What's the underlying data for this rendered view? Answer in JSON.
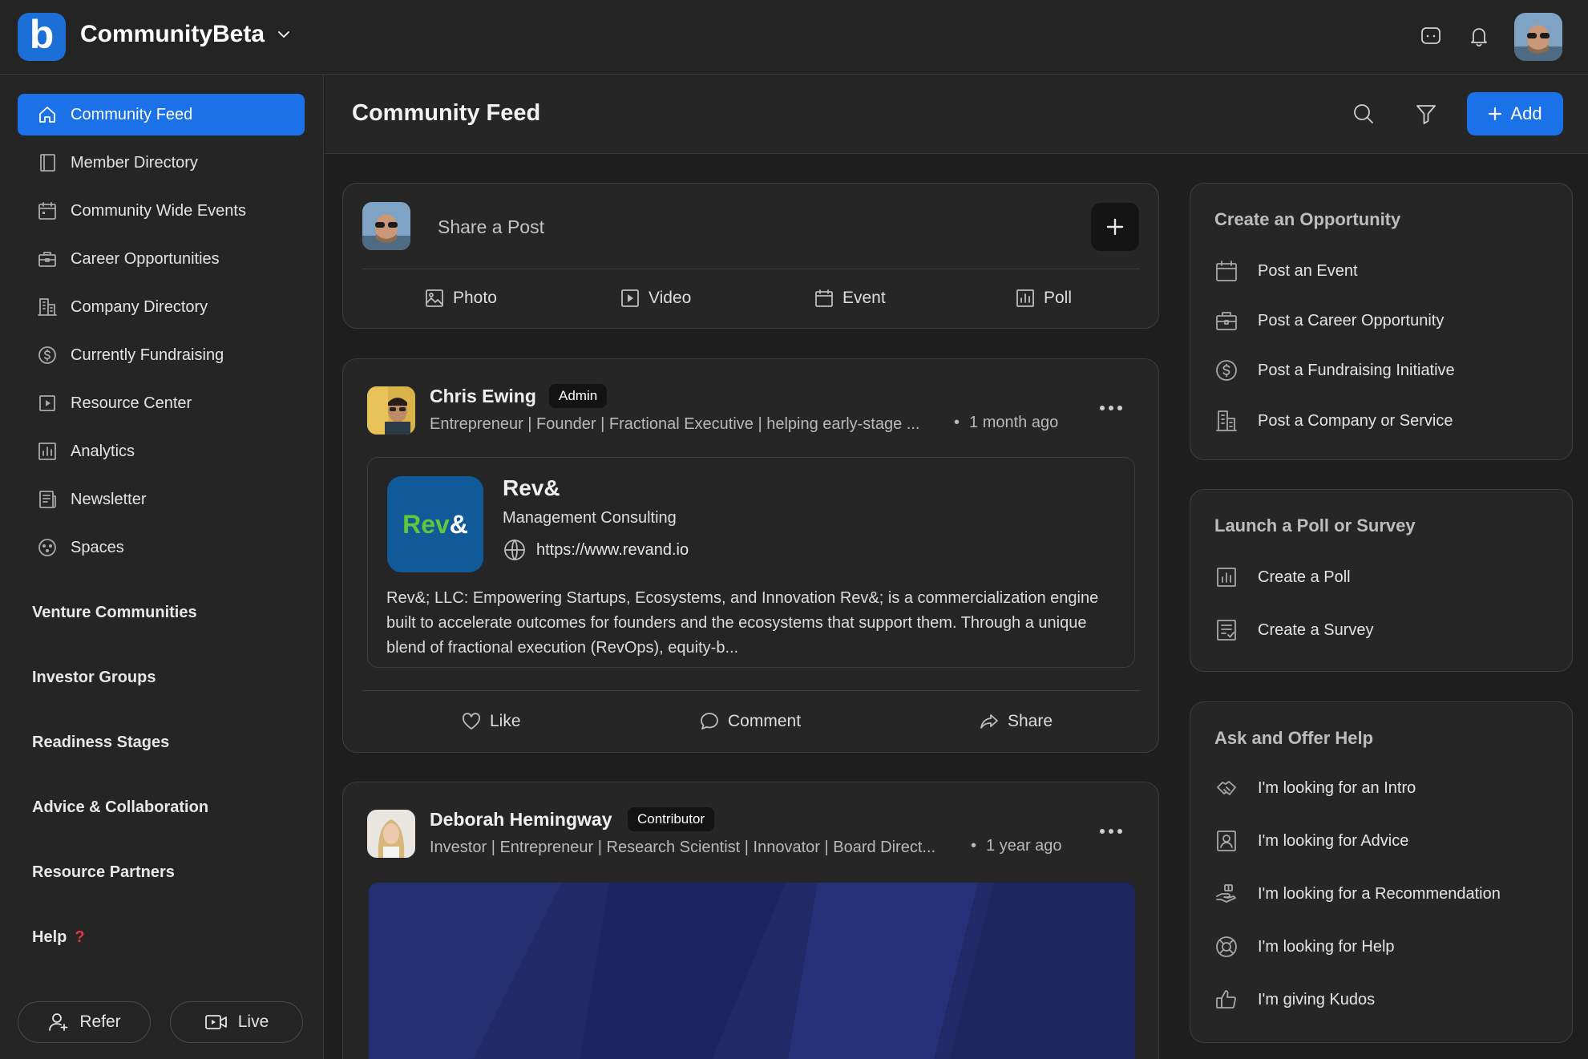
{
  "app": {
    "brand": "CommunityBeta",
    "logo_letter": "b"
  },
  "sidebar": {
    "items": [
      {
        "label": "Community Feed",
        "icon": "home-icon",
        "active": true
      },
      {
        "label": "Member Directory",
        "icon": "book-icon"
      },
      {
        "label": "Community Wide Events",
        "icon": "calendar-icon"
      },
      {
        "label": "Career Opportunities",
        "icon": "briefcase-icon"
      },
      {
        "label": "Company Directory",
        "icon": "building-icon"
      },
      {
        "label": "Currently Fundraising",
        "icon": "dollar-icon"
      },
      {
        "label": "Resource Center",
        "icon": "play-square-icon"
      },
      {
        "label": "Analytics",
        "icon": "bar-chart-icon"
      },
      {
        "label": "Newsletter",
        "icon": "newspaper-icon"
      },
      {
        "label": "Spaces",
        "icon": "group-icon"
      }
    ],
    "sections": [
      "Venture Communities",
      "Investor Groups",
      "Readiness Stages",
      "Advice & Collaboration",
      "Resource Partners",
      "Help"
    ],
    "help_mark": "?",
    "refer_label": "Refer",
    "live_label": "Live"
  },
  "header": {
    "title": "Community Feed",
    "add_label": "Add"
  },
  "composer": {
    "placeholder": "Share a Post",
    "actions": [
      "Photo",
      "Video",
      "Event",
      "Poll"
    ]
  },
  "posts": [
    {
      "author": "Chris Ewing",
      "badge": "Admin",
      "headline": "Entrepreneur | Founder | Fractional Executive | helping early-stage ...",
      "time": "1 month ago",
      "company": {
        "logo_text": "Rev",
        "logo_amp": "&",
        "name": "Rev&",
        "category": "Management Consulting",
        "url": "https://www.revand.io",
        "description": "Rev&; LLC: Empowering Startups, Ecosystems, and Innovation Rev&; is a commercialization engine built to accelerate outcomes for founders and the ecosystems that support them. Through a unique blend of fractional execution (RevOps), equity-b..."
      },
      "actions": [
        "Like",
        "Comment",
        "Share"
      ]
    },
    {
      "author": "Deborah Hemingway",
      "badge": "Contributor",
      "headline": "Investor | Entrepreneur | Research Scientist | Innovator | Board Direct...",
      "time": "1 year ago"
    }
  ],
  "bullet": "•",
  "right_panel": {
    "opportunity": {
      "title": "Create an Opportunity",
      "items": [
        "Post an Event",
        "Post a Career Opportunity",
        "Post a Fundraising Initiative",
        "Post a Company or Service"
      ]
    },
    "poll": {
      "title": "Launch a Poll or Survey",
      "items": [
        "Create a Poll",
        "Create a Survey"
      ]
    },
    "help": {
      "title": "Ask and Offer Help",
      "items": [
        "I'm looking for an Intro",
        "I'm looking for Advice",
        "I'm looking for a Recommendation",
        "I'm looking for Help",
        "I'm giving Kudos"
      ]
    }
  },
  "colors": {
    "accent": "#1b72e8",
    "background": "#1e1e1e",
    "card": "#262626",
    "rev_green": "#5ec83a",
    "rev_blue": "#115a9a"
  }
}
